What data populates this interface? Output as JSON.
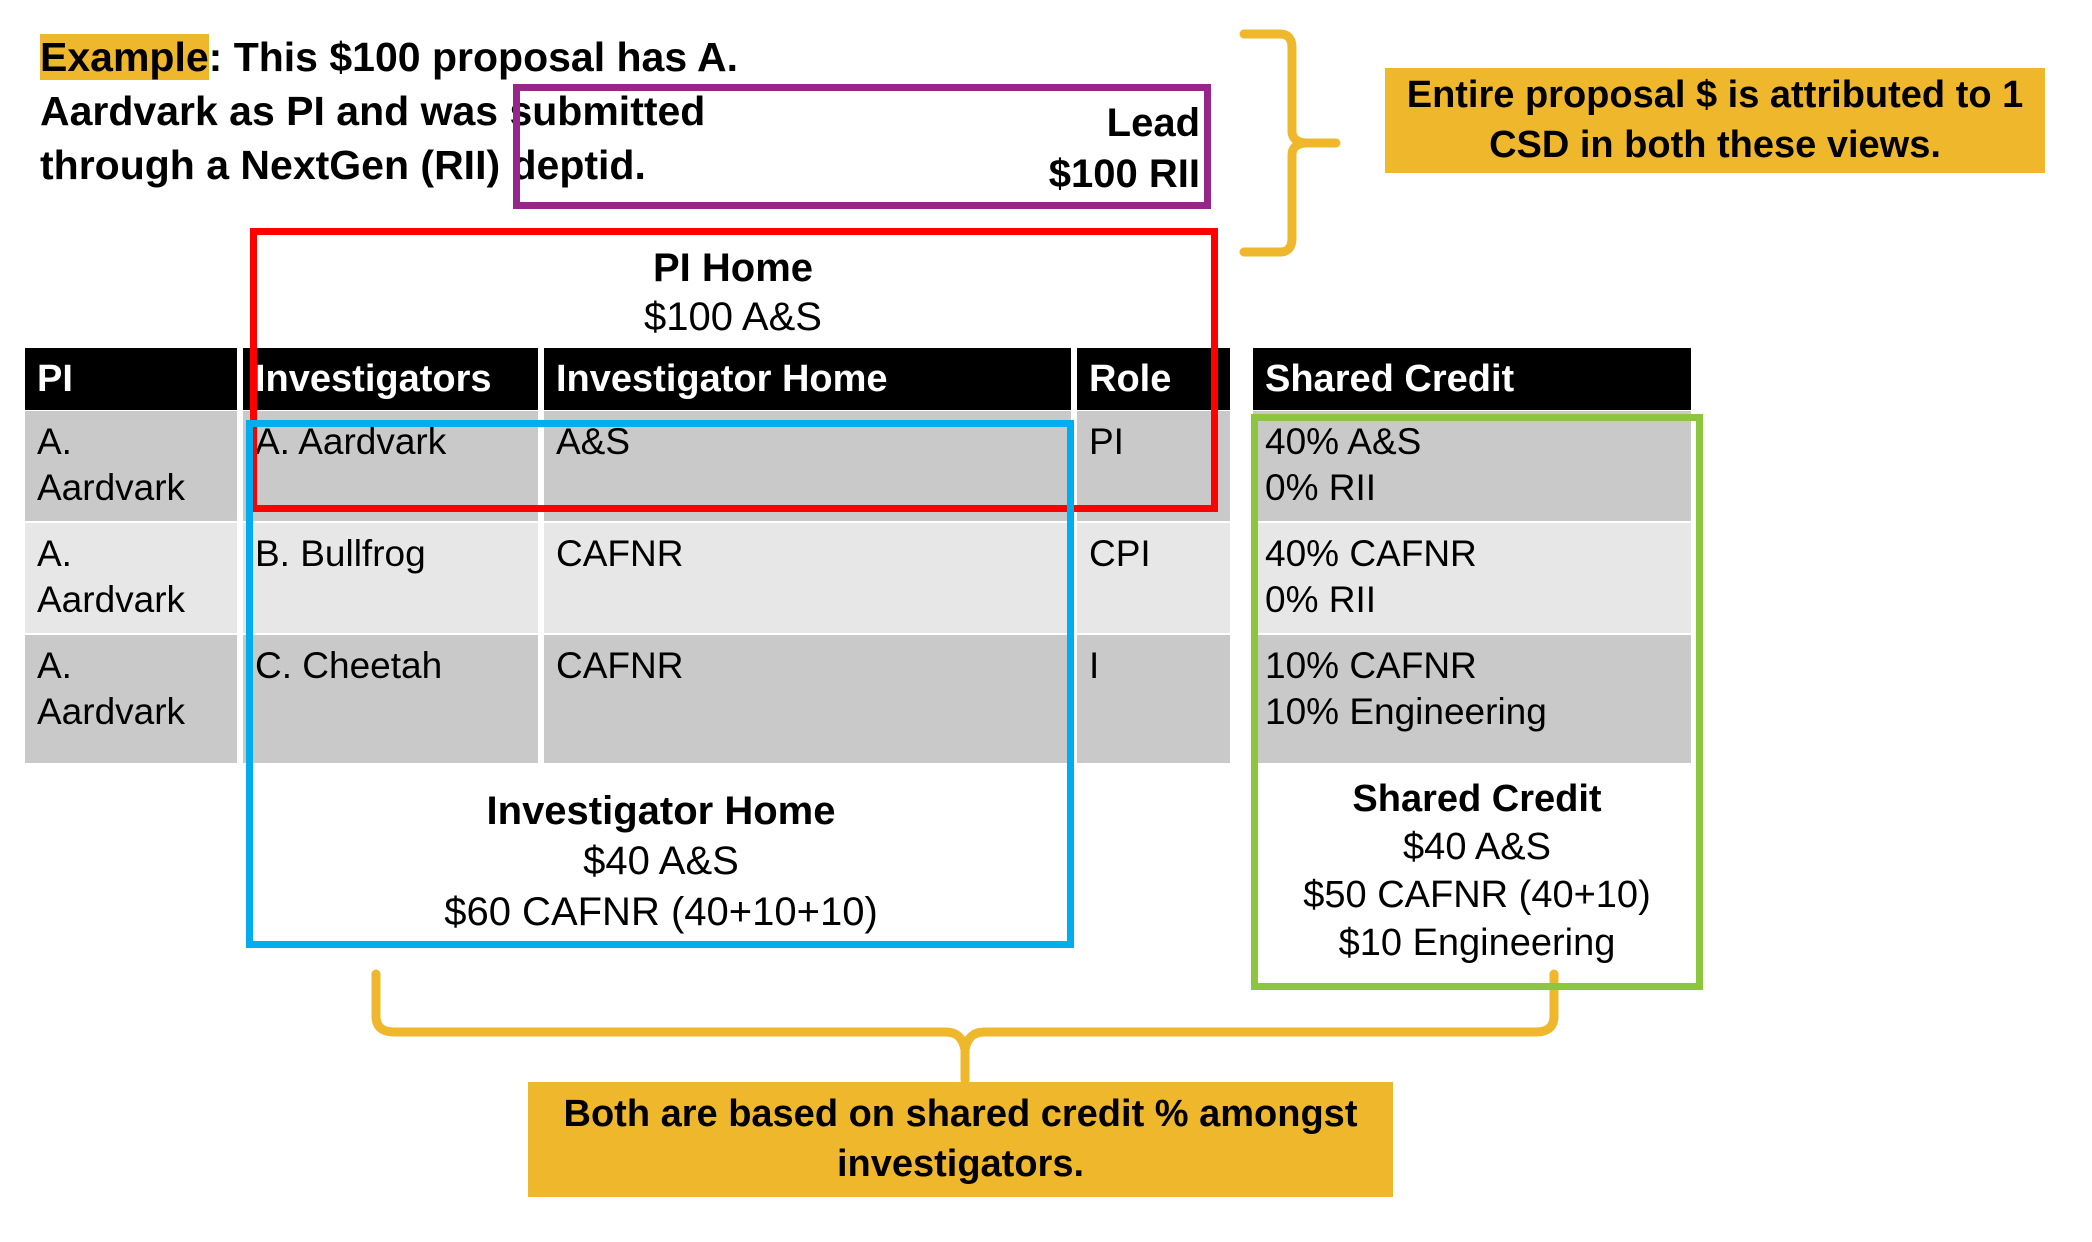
{
  "intro": {
    "highlight": "Example",
    "rest": ": This $100 proposal has A. Aardvark as PI and was submitted through a NextGen (RII) deptid."
  },
  "lead_box": {
    "title": "Lead",
    "amount": "$100 RII"
  },
  "callouts": {
    "top": "Entire proposal $ is attributed to 1 CSD in both these views.",
    "bottom": "Both are based on shared credit % amongst investigators."
  },
  "annotations": {
    "pi_home": {
      "title": "PI Home",
      "line1": "$100 A&S"
    },
    "investigator_home": {
      "title": "Investigator Home",
      "line1": "$40 A&S",
      "line2": "$60 CAFNR (40+10+10)"
    },
    "shared_credit": {
      "title": "Shared Credit",
      "line1": "$40 A&S",
      "line2": "$50 CAFNR (40+10)",
      "line3": "$10 Engineering"
    }
  },
  "table": {
    "headers": {
      "pi": "PI",
      "investigators": "Investigators",
      "investigator_home": "Investigator Home",
      "role": "Role",
      "shared_credit": "Shared Credit"
    },
    "rows": [
      {
        "pi": "A.\nAardvark",
        "investigator": "A. Aardvark",
        "home": "A&S",
        "role": "PI",
        "shared_credit": "40% A&S\n0% RII"
      },
      {
        "pi": "A.\nAardvark",
        "investigator": "B. Bullfrog",
        "home": "CAFNR",
        "role": "CPI",
        "shared_credit": "40% CAFNR\n0% RII"
      },
      {
        "pi": "A.\nAardvark",
        "investigator": "C. Cheetah",
        "home": "CAFNR",
        "role": "I",
        "shared_credit": "10% CAFNR\n10% Engineering"
      }
    ]
  },
  "colors": {
    "gold": "#EFB82C",
    "purple": "#97268B",
    "red": "#FF0000",
    "blue": "#00AEEF",
    "green": "#8CC63E",
    "header_bg": "#000000",
    "row_shade_dark": "#C9C9C9",
    "row_shade_light": "#E7E7E7"
  }
}
